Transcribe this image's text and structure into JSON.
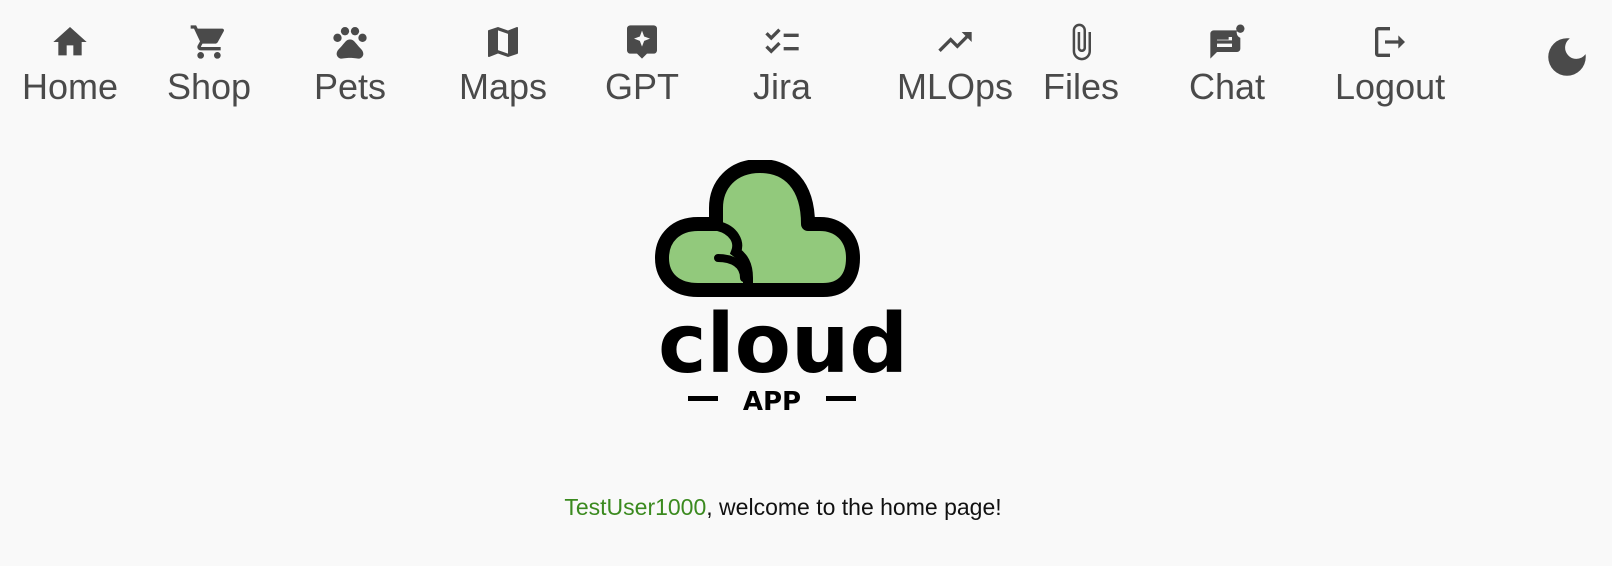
{
  "nav": {
    "items": [
      {
        "label": "Home",
        "icon": "home-icon"
      },
      {
        "label": "Shop",
        "icon": "cart-icon"
      },
      {
        "label": "Pets",
        "icon": "paw-icon"
      },
      {
        "label": "Maps",
        "icon": "map-icon"
      },
      {
        "label": "GPT",
        "icon": "sparkle-chat-icon"
      },
      {
        "label": "Jira",
        "icon": "checklist-icon"
      },
      {
        "label": "MLOps",
        "icon": "trending-up-icon"
      },
      {
        "label": "Files",
        "icon": "paperclip-icon"
      },
      {
        "label": "Chat",
        "icon": "chat-notification-icon"
      },
      {
        "label": "Logout",
        "icon": "logout-icon"
      }
    ],
    "theme_toggle_icon": "moon-icon"
  },
  "logo": {
    "word": "cloud",
    "subword": "APP",
    "cloud_color": "#92c97c",
    "outline_color": "#000000"
  },
  "welcome": {
    "username": "TestUser1000",
    "message": ", welcome to the home page!",
    "username_color": "#3b8a1f"
  }
}
